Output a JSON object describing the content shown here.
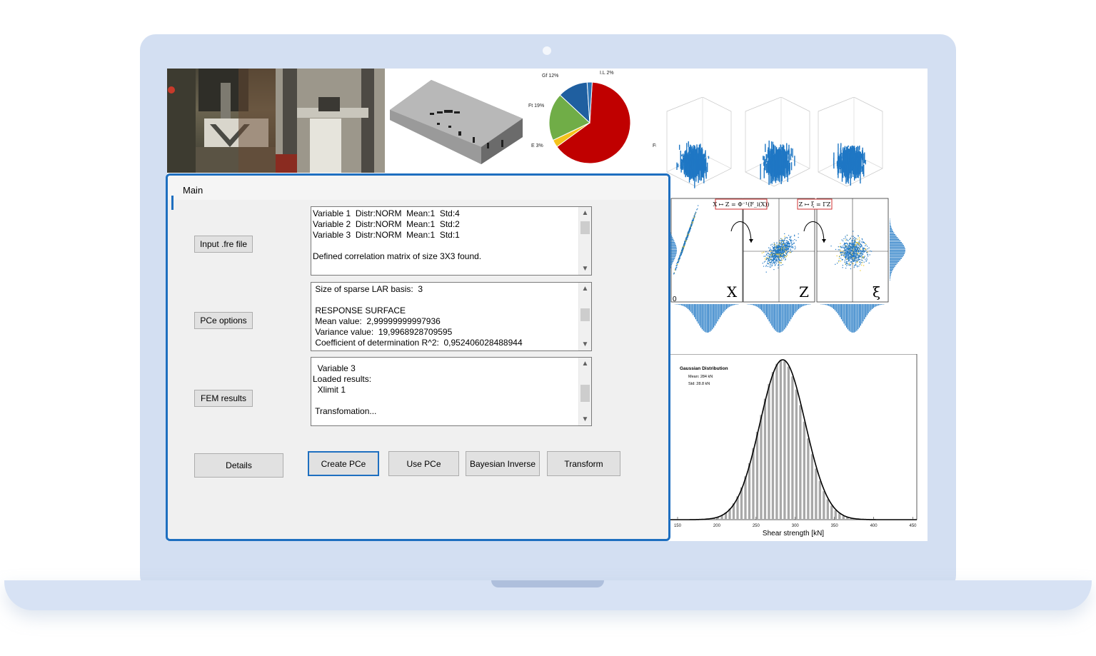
{
  "window": {
    "title": "Main",
    "buttons": {
      "input_fre": "Input .fre file",
      "pce_options": "PCe options",
      "fem_results": "FEM results",
      "details": "Details",
      "create_pce": "Create PCe",
      "use_pce": "Use PCe",
      "bayesian_inverse": "Bayesian Inverse",
      "transform": "Transform"
    },
    "textbox1": {
      "lines": [
        "Variable 1  Distr:NORM  Mean:1  Std:4",
        "Variable 2  Distr:NORM  Mean:1  Std:2",
        "Variable 3  Distr:NORM  Mean:1  Std:1",
        "",
        "Defined correlation matrix of size 3X3 found."
      ]
    },
    "textbox2": {
      "lines": [
        " Size of sparse LAR basis:  3",
        "",
        " RESPONSE SURFACE",
        " Mean value:  2,99999999997936",
        " Variance value:  19,9968928709595",
        " Coefficient of determination R^2:  0,952406028488944"
      ]
    },
    "textbox3": {
      "lines": [
        "  Variable 3",
        "Loaded results:",
        "  Xlimit 1",
        "",
        " Transfomation..."
      ]
    }
  },
  "pie_chart": {
    "chart_data": {
      "type": "pie",
      "slices": [
        {
          "label": "Fr",
          "value": 64,
          "color": "#c00000"
        },
        {
          "label": "E 3%",
          "value": 3,
          "color": "#f4c21c"
        },
        {
          "label": "Ft 19%",
          "value": 19,
          "color": "#70ad47"
        },
        {
          "label": "Gf 12%",
          "value": 12,
          "color": "#1f5fa0"
        },
        {
          "label": "I.L 2%",
          "value": 2,
          "color": "#2e75b6"
        }
      ]
    }
  },
  "transform_figure": {
    "formula1": "X ↦ Z = Φ⁻¹(F_i(X))",
    "formula2": "Z ↦ ξ = ΓZ",
    "labels": [
      "X",
      "Z",
      "ξ"
    ],
    "origin_label": "0"
  },
  "gaussian_chart": {
    "chart_data": {
      "type": "bar",
      "title": "Gaussian Distribution",
      "annotations": [
        "Mean: 284 kN",
        "Std: 28.8 kN"
      ],
      "xlabel": "Shear strength [kN]",
      "xticks": [
        "150",
        "200",
        "250",
        "300",
        "350",
        "400",
        "450"
      ],
      "xlim": [
        140,
        455
      ],
      "mean": 284,
      "std": 28.8
    }
  }
}
